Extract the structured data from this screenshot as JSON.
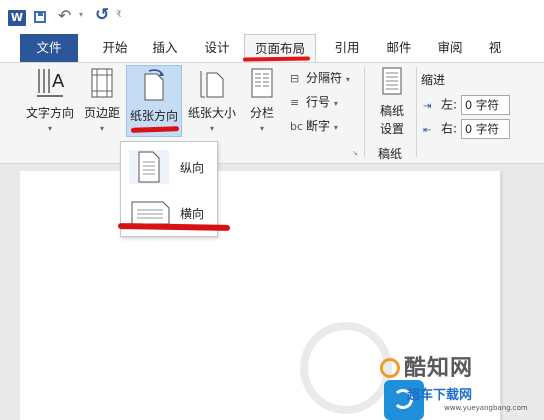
{
  "qat": {
    "app_icon": "W",
    "save_icon": "save-icon",
    "undo_icon": "undo-icon",
    "redo_icon": "redo-icon",
    "undo_glyph": "↶",
    "redo_glyph": "↺",
    "dropdown_glyph": "▾",
    "more_glyph": "₹"
  },
  "tabs": [
    {
      "label": "文件"
    },
    {
      "label": "开始"
    },
    {
      "label": "插入"
    },
    {
      "label": "设计"
    },
    {
      "label": "页面布局"
    },
    {
      "label": "引用"
    },
    {
      "label": "邮件"
    },
    {
      "label": "审阅"
    },
    {
      "label": "视"
    }
  ],
  "ribbon": {
    "text_direction": "文字方向",
    "margins": "页边距",
    "orientation": "纸张方向",
    "size": "纸张大小",
    "columns": "分栏",
    "breaks": "分隔符",
    "line_numbers": "行号",
    "hyphenation": "断字",
    "draft_paper_l1": "稿纸",
    "draft_paper_l2": "设置",
    "draft_group": "稿纸",
    "indent_title": "缩进",
    "indent_left_label": "左:",
    "indent_left_value": "0 字符",
    "indent_right_label": "右:",
    "indent_right_value": "0 字符",
    "dropdown_glyph": "▾"
  },
  "orientation_menu": {
    "items": [
      {
        "label": "纵向",
        "icon": "portrait-page-icon"
      },
      {
        "label": "横向",
        "icon": "landscape-page-icon"
      }
    ]
  },
  "watermarks": {
    "brand1": "酷知网",
    "brand2": "超车下载网",
    "brand2_url": "www.yueyangbang.com"
  },
  "colors": {
    "file_tab": "#2b579a",
    "annotation": "#d81212",
    "selected": "#c5dcf4"
  }
}
